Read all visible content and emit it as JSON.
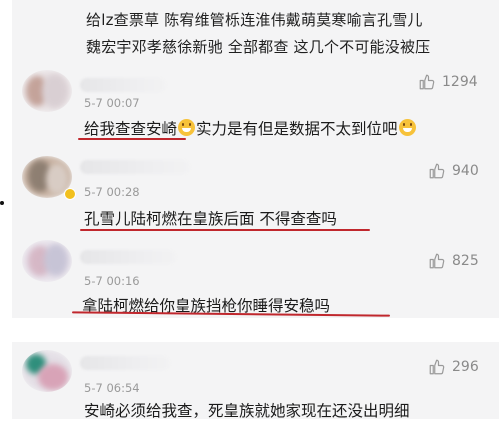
{
  "top_comment": {
    "line1": "给lz查票草 陈宥维管栎连淮伟戴萌莫寒喻言孔雪儿",
    "line2": "魏宏宇邓孝慈徐新驰 全部都查 这几个不可能没被压"
  },
  "comments": [
    {
      "avatar_colors": [
        "#c4a39a",
        "#d9cfd3",
        "#e9e2e4"
      ],
      "timestamp": "5-7 00:07",
      "text_parts": [
        "给我查查安崎",
        "实力是有但是数据不太到位吧",
        ""
      ],
      "emojis": [
        "grin-emoji",
        "grin-emoji"
      ],
      "likes": "1294"
    },
    {
      "avatar_colors": [
        "#8e7f72",
        "#d8ccc4",
        "#c9b3a3"
      ],
      "timestamp": "5-7 00:28",
      "text": "孔雪儿陆柯燃在皇族后面 不得查查吗",
      "likes": "940"
    },
    {
      "avatar_colors": [
        "#d6b8c6",
        "#c7c4d6",
        "#e7e1ea"
      ],
      "timestamp": "5-7 00:16",
      "text": "拿陆柯燃给你皇族挡枪你睡得安稳吗",
      "likes": "825"
    },
    {
      "avatar_colors": [
        "#2f8f7c",
        "#d8a3b7",
        "#e4dfe6"
      ],
      "timestamp": "5-7 06:54",
      "text": "安崎必须给我查，死皇族就她家现在还没出明细",
      "likes": "296"
    }
  ],
  "colors": {
    "underline": "#c0272d",
    "panel_bg": "#f4f4f5",
    "timestamp": "#9a9a9a",
    "like_count": "#8a8a8a"
  },
  "icons": {
    "like": "thumbs-up-icon",
    "verified": "verified-badge-icon",
    "emoji": "grin-emoji"
  }
}
